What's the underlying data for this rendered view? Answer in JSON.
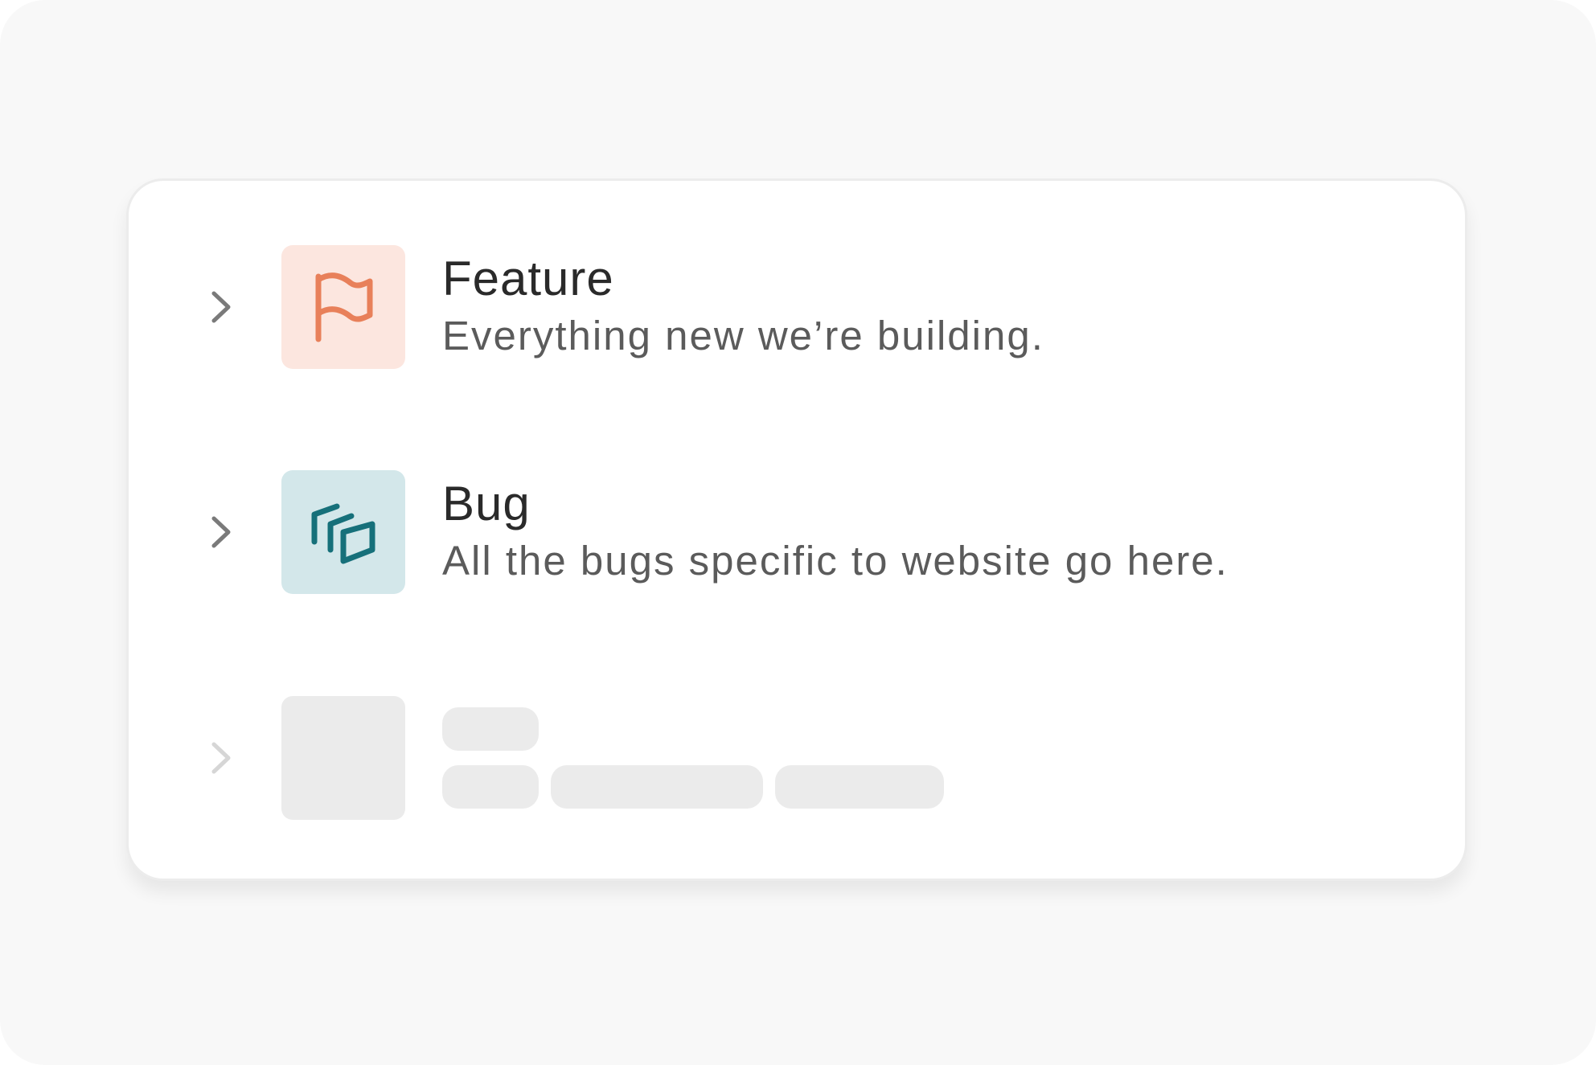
{
  "items": [
    {
      "title": "Feature",
      "description": "Everything new we’re building.",
      "icon": "flag-icon",
      "icon_color": "#e8805a",
      "tile_color": "#fce6df"
    },
    {
      "title": "Bug",
      "description": "All the bugs specific to website go here.",
      "icon": "stacked-squares-icon",
      "icon_color": "#16707a",
      "tile_color": "#d3e7ea"
    }
  ],
  "placeholder": {
    "state": "loading",
    "skeleton_color": "#ebebeb"
  },
  "colors": {
    "page_background": "#f8f8f8",
    "card_background": "#ffffff",
    "chevron": "#7a7a7a",
    "chevron_disabled": "#d6d6d6",
    "title_text": "#2a2a2a",
    "description_text": "#5b5b5b"
  }
}
